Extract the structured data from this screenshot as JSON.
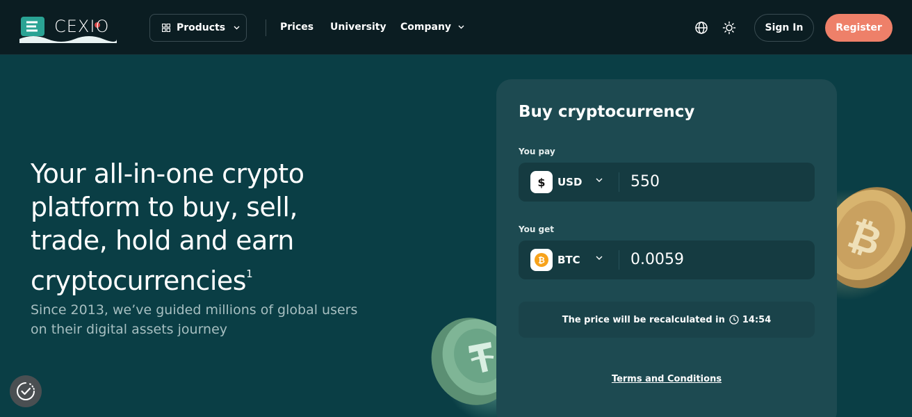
{
  "header": {
    "logo_text": "CEXIO",
    "products_label": "Products",
    "nav": [
      {
        "label": "Prices"
      },
      {
        "label": "University"
      },
      {
        "label": "Company"
      }
    ],
    "signin_label": "Sign In",
    "register_label": "Register"
  },
  "hero": {
    "title": "Your all-in-one crypto platform to buy, sell, trade, hold and earn cryptocurrencies",
    "title_footnote": "1",
    "subtitle": "Since 2013, we’ve guided millions of global users on their digital assets journey"
  },
  "buy_card": {
    "title": "Buy cryptocurrency",
    "pay": {
      "label": "You pay",
      "currency_symbol": "$",
      "currency": "USD",
      "amount": "550"
    },
    "get": {
      "label": "You get",
      "currency_symbol": "₿",
      "currency": "BTC",
      "amount": "0.0059"
    },
    "recalc_text": "The price will be recalculated in",
    "countdown": "14:54",
    "terms_link": "Terms and Conditions"
  },
  "colors": {
    "header_bg": "#0b1d22",
    "page_bg": "#0a3e45",
    "card_bg": "#1d4a51",
    "accent": "#ee8069",
    "btc_orange": "#f7a21b"
  },
  "icons": {
    "products": "grid-icon",
    "language": "globe-icon",
    "theme": "sun-icon",
    "consent": "badge-check-icon"
  }
}
